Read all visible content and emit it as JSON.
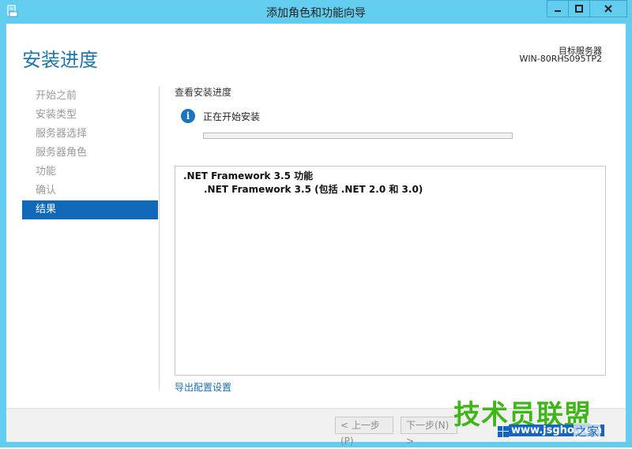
{
  "window": {
    "title": "添加角色和功能向导",
    "colors": {
      "frame": "#63cdf0",
      "accent": "#1168b8",
      "title": "#1f78a8",
      "link": "#1f6ea8"
    }
  },
  "header": {
    "page_title": "安装进度",
    "target_label": "目标服务器",
    "target_name": "WIN-80RHS095TP2"
  },
  "nav": {
    "items": [
      {
        "label": "开始之前"
      },
      {
        "label": "安装类型"
      },
      {
        "label": "服务器选择"
      },
      {
        "label": "服务器角色"
      },
      {
        "label": "功能"
      },
      {
        "label": "确认"
      },
      {
        "label": "结果"
      }
    ],
    "active_index": 6
  },
  "main": {
    "section_label": "查看安装进度",
    "status_icon": "info-icon",
    "status_text": "正在开始安装",
    "progress": 0,
    "features": [
      ".NET Framework 3.5 功能",
      ".NET Framework 3.5 (包括 .NET 2.0 和 3.0)"
    ],
    "export_link": "导出配置设置"
  },
  "footer": {
    "prev_label": "< 上一步(P)",
    "next_label": "下一步(N) >"
  },
  "watermark": {
    "brand": "技术员联盟",
    "url": "www.jsgho.com",
    "tail": "之家"
  }
}
